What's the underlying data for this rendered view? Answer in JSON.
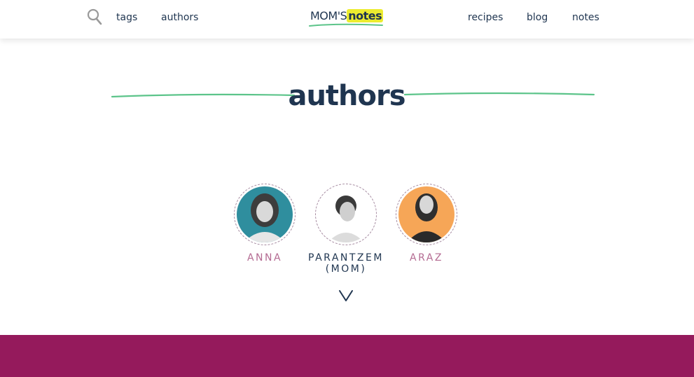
{
  "header": {
    "nav_left": [
      "tags",
      "authors"
    ],
    "logo": {
      "part1": "MOM'S",
      "part2": "notes"
    },
    "nav_right": [
      "recipes",
      "blog",
      "notes"
    ]
  },
  "page": {
    "title": "authors"
  },
  "authors": [
    {
      "name": "ANNA",
      "avatar_bg": "#2f8e9e",
      "name_color": "#b46b92"
    },
    {
      "name": "PARANTZEM (MOM)",
      "avatar_bg": "#ffffff",
      "name_color": "#1f3550"
    },
    {
      "name": "ARAZ",
      "avatar_bg": "#f6a657",
      "name_color": "#b46b92"
    }
  ],
  "colors": {
    "text": "#1f3550",
    "accent_green": "#5cc48a",
    "logo_highlight": "#ecec2f",
    "footer": "#951a5c"
  },
  "icons": {
    "search": "search-icon",
    "more": "chevron-down-icon"
  }
}
